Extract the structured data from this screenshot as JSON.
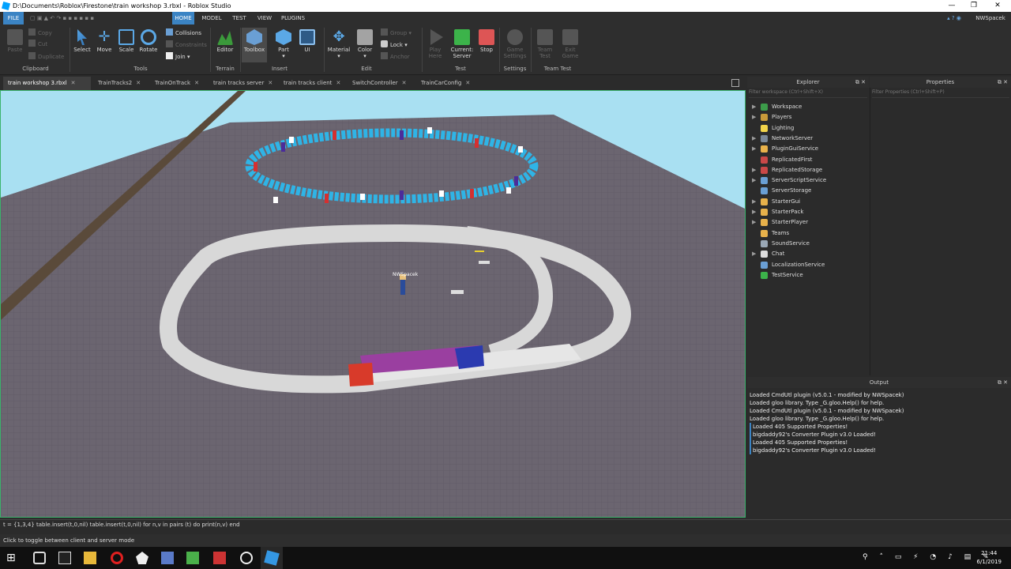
{
  "window": {
    "title": "D:\\Documents\\Roblox\\Firestone\\train workshop 3.rbxl - Roblox Studio",
    "minimize": "—",
    "maximize": "❐",
    "close": "✕"
  },
  "menu": [
    "FILE",
    "HOME",
    "MODEL",
    "TEST",
    "VIEW",
    "PLUGINS"
  ],
  "user": "NWSpacek",
  "ribbon": {
    "paste": "Paste",
    "copy": "Copy",
    "cut": "Cut",
    "duplicate": "Duplicate",
    "select": "Select",
    "move": "Move",
    "scale": "Scale",
    "rotate": "Rotate",
    "collisions": "Collisions",
    "constraints": "Constraints",
    "join": "Join",
    "editor": "Editor",
    "toolbox": "Toolbox",
    "part": "Part",
    "ui": "UI",
    "material": "Material",
    "color": "Color",
    "group": "Group",
    "lock": "Lock",
    "anchor": "Anchor",
    "play_here_1": "Play",
    "play_here_2": "Here",
    "current_1": "Current:",
    "current_2": "Server",
    "stop": "Stop",
    "game_settings_1": "Game",
    "game_settings_2": "Settings",
    "team_test_1": "Team",
    "team_test_2": "Test",
    "exit_game_1": "Exit",
    "exit_game_2": "Game",
    "groups": {
      "clipboard": "Clipboard",
      "tools": "Tools",
      "terrain": "Terrain",
      "insert": "Insert",
      "edit": "Edit",
      "test": "Test",
      "settings": "Settings",
      "team_test": "Team Test"
    }
  },
  "tabs": [
    "train workshop 3.rbxl",
    "TrainTracks2",
    "TrainOnTrack",
    "train tracks server",
    "train tracks client",
    "SwitchController",
    "TrainCarConfig"
  ],
  "viewport": {
    "player_label": "NWSpacek"
  },
  "explorer": {
    "title": "Explorer",
    "filter": "Filter workspace (Ctrl+Shift+X)",
    "items": [
      {
        "label": "Workspace",
        "color": "#3c9c4a"
      },
      {
        "label": "Players",
        "color": "#c89a3a"
      },
      {
        "label": "Lighting",
        "color": "#f2d44a"
      },
      {
        "label": "NetworkServer",
        "color": "#7a8796"
      },
      {
        "label": "PluginGuiService",
        "color": "#e8b24b"
      },
      {
        "label": "ReplicatedFirst",
        "color": "#c94848"
      },
      {
        "label": "ReplicatedStorage",
        "color": "#c94848"
      },
      {
        "label": "ServerScriptService",
        "color": "#6a9fd4"
      },
      {
        "label": "ServerStorage",
        "color": "#6a9fd4"
      },
      {
        "label": "StarterGui",
        "color": "#e8b24b"
      },
      {
        "label": "StarterPack",
        "color": "#e8b24b"
      },
      {
        "label": "StarterPlayer",
        "color": "#e8b24b"
      },
      {
        "label": "Teams",
        "color": "#e8b24b"
      },
      {
        "label": "SoundService",
        "color": "#9aa8b6"
      },
      {
        "label": "Chat",
        "color": "#dddddd"
      },
      {
        "label": "LocalizationService",
        "color": "#6a9fd4"
      },
      {
        "label": "TestService",
        "color": "#3cb34a"
      }
    ]
  },
  "properties": {
    "title": "Properties",
    "filter": "Filter Properties (Ctrl+Shift+P)"
  },
  "output": {
    "title": "Output",
    "lines": [
      "Loaded CmdUtl plugin (v5.0.1 - modified by NWSpacek)",
      "Loaded gloo library. Type _G.gloo.Help() for help.",
      "Loaded CmdUtl plugin (v5.0.1 - modified by NWSpacek)",
      "Loaded gloo library. Type _G.gloo.Help() for help.",
      "Loaded 405 Supported Properties!",
      "bigdaddy92's Converter Plugin v3.0 Loaded!",
      "Loaded 405 Supported Properties!",
      "bigdaddy92's Converter Plugin v3.0 Loaded!"
    ]
  },
  "command_bar": "t = {1,3,4} table.insert(t,0,nil) table.insert(t,0,nil) for n,v in pairs (t) do print(n,v) end",
  "status_bar": "Click to toggle between client and server mode",
  "clock": {
    "time": "21:44",
    "date": "6/1/2019"
  }
}
